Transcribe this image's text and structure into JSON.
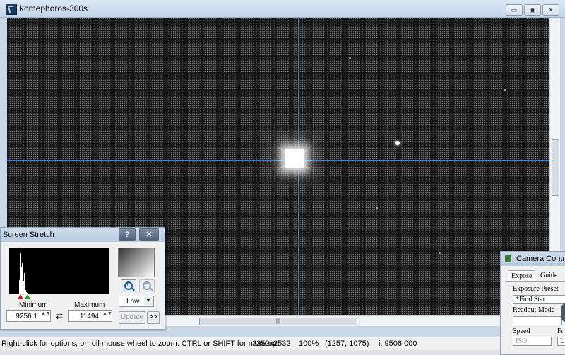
{
  "window": {
    "title": "komephoros-300s",
    "buttons": {
      "minimize": "▭",
      "restore": "▣",
      "close": "✕"
    }
  },
  "scrollbar": {
    "grip": "|||"
  },
  "statusbar": {
    "hint": "Right-click for options, or roll mouse wheel to zoom. CTRL or SHIFT for more opt",
    "dimensions": "3352x2532",
    "zoom": "100%",
    "coords": "(1257, 1075)",
    "intensity": "i:  9506.000"
  },
  "screen_stretch": {
    "title": "Screen Stretch",
    "help_label": "?",
    "close_label": "✕",
    "minimum_label": "Minimum",
    "maximum_label": "Maximum",
    "minimum_value": "9256.1",
    "maximum_value": "11494",
    "spin_arrows": "▲▼",
    "swap_label": "⇄",
    "mode_value": "Low",
    "dropdown_arrow": "▼",
    "update_label": "Update",
    "more_label": ">>"
  },
  "camera_control": {
    "title": "Camera Control",
    "tabs": [
      "Expose",
      "Guide"
    ],
    "exposure_preset_label": "Exposure Preset",
    "exposure_preset_value": "*Find Star",
    "readout_mode_label": "Readout Mode",
    "speed_label": "Speed",
    "speed_value": "ISO",
    "fr_label": "Fr",
    "fr_value": "L"
  },
  "colors": {
    "crosshair": "#3b79c9",
    "titlebar": "#c3d3e8"
  }
}
